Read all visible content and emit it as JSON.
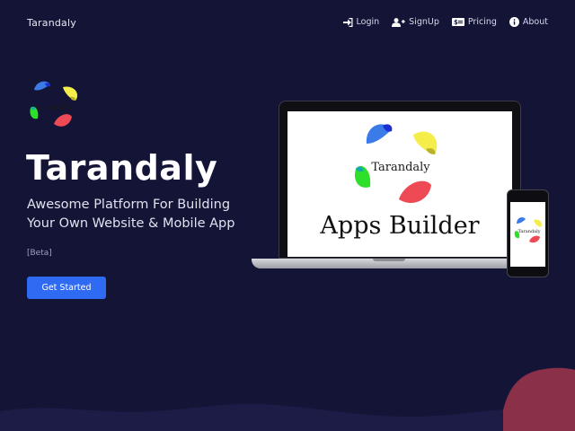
{
  "brand": {
    "name": "Tarandaly"
  },
  "nav": {
    "items": [
      {
        "label": "Login",
        "icon": "login-icon"
      },
      {
        "label": "SignUp",
        "icon": "user-plus-icon"
      },
      {
        "label": "Pricing",
        "icon": "dollar-bill-icon"
      },
      {
        "label": "About",
        "icon": "info-icon"
      }
    ]
  },
  "hero": {
    "logo_text": "Tarandaly",
    "title": "Tarandaly",
    "subtitle": "Awesome Platform For Building Your Own Website & Mobile App",
    "badge": "[Beta]",
    "cta_label": "Get Started"
  },
  "mockup": {
    "laptop_logo_text": "Tarandaly",
    "laptop_caption": "Apps Builder",
    "phone_logo_text": "Tarandaly"
  },
  "colors": {
    "background": "#141437",
    "accent": "#2f6bf2",
    "logo_blue": "#3b7be8",
    "logo_yellow": "#f5ee4a",
    "logo_green": "#2fe02a",
    "logo_red": "#ee4a55",
    "wave": "#8a3048"
  }
}
